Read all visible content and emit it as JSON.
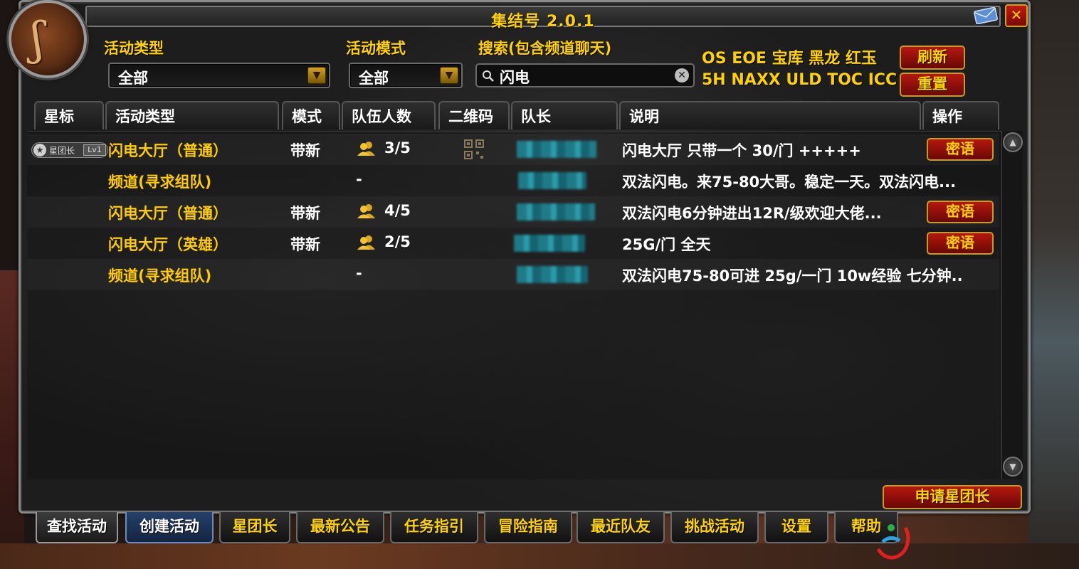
{
  "window": {
    "title": "集结号 2.0.1"
  },
  "filters": {
    "activity_type_label": "活动类型",
    "activity_type_value": "全部",
    "activity_mode_label": "活动模式",
    "activity_mode_value": "全部",
    "search_label": "搜索(包含频道聊天)",
    "search_value": "闪电"
  },
  "quick_links": {
    "row1": "OS EOE 宝库 黑龙 红玉",
    "row2": "5H NAXX ULD TOC ICC"
  },
  "buttons": {
    "refresh": "刷新",
    "reset": "重置",
    "apply_star_leader": "申请星团长"
  },
  "table": {
    "columns": [
      "星标",
      "活动类型",
      "模式",
      "队伍人数",
      "二维码",
      "队长",
      "说明",
      "操作"
    ],
    "rows": [
      {
        "star": "星团长",
        "star_level": "Lv1",
        "type": "闪电大厅（普通）",
        "mode": "带新",
        "members": "3/5",
        "note": "闪电大厅 只带一个 30/门 +++++",
        "action": "密语"
      },
      {
        "star": "",
        "star_level": "",
        "type": "频道(寻求组队)",
        "mode": "",
        "members": "-",
        "note": "双法闪电。来75-80大哥。稳定一天。双法闪电...",
        "action": ""
      },
      {
        "star": "",
        "star_level": "",
        "type": "闪电大厅（普通）",
        "mode": "带新",
        "members": "4/5",
        "note": "双法闪电6分钟进出12R/级欢迎大佬...",
        "action": "密语"
      },
      {
        "star": "",
        "star_level": "",
        "type": "闪电大厅（英雄）",
        "mode": "带新",
        "members": "2/5",
        "note": "25G/门 全天",
        "action": "密语"
      },
      {
        "star": "",
        "star_level": "",
        "type": "频道(寻求组队)",
        "mode": "",
        "members": "-",
        "note": "双法闪电75-80可进 25g/一门 10w经验 七分钟..",
        "action": ""
      }
    ]
  },
  "tabs": [
    "查找活动",
    "创建活动",
    "星团长",
    "最新公告",
    "任务指引",
    "冒险指南",
    "最近队友",
    "挑战活动",
    "设置",
    "帮助"
  ],
  "colors": {
    "gold": "#ffd200",
    "button_red": "#b4180e",
    "frame": "#1d1d1d"
  },
  "icons": [
    "portrait-icon",
    "mail-icon",
    "close-icon",
    "dropdown-arrow-icon",
    "search-icon",
    "clear-icon",
    "people-icon",
    "qr-code-icon",
    "scroll-up-icon",
    "scroll-down-icon"
  ]
}
